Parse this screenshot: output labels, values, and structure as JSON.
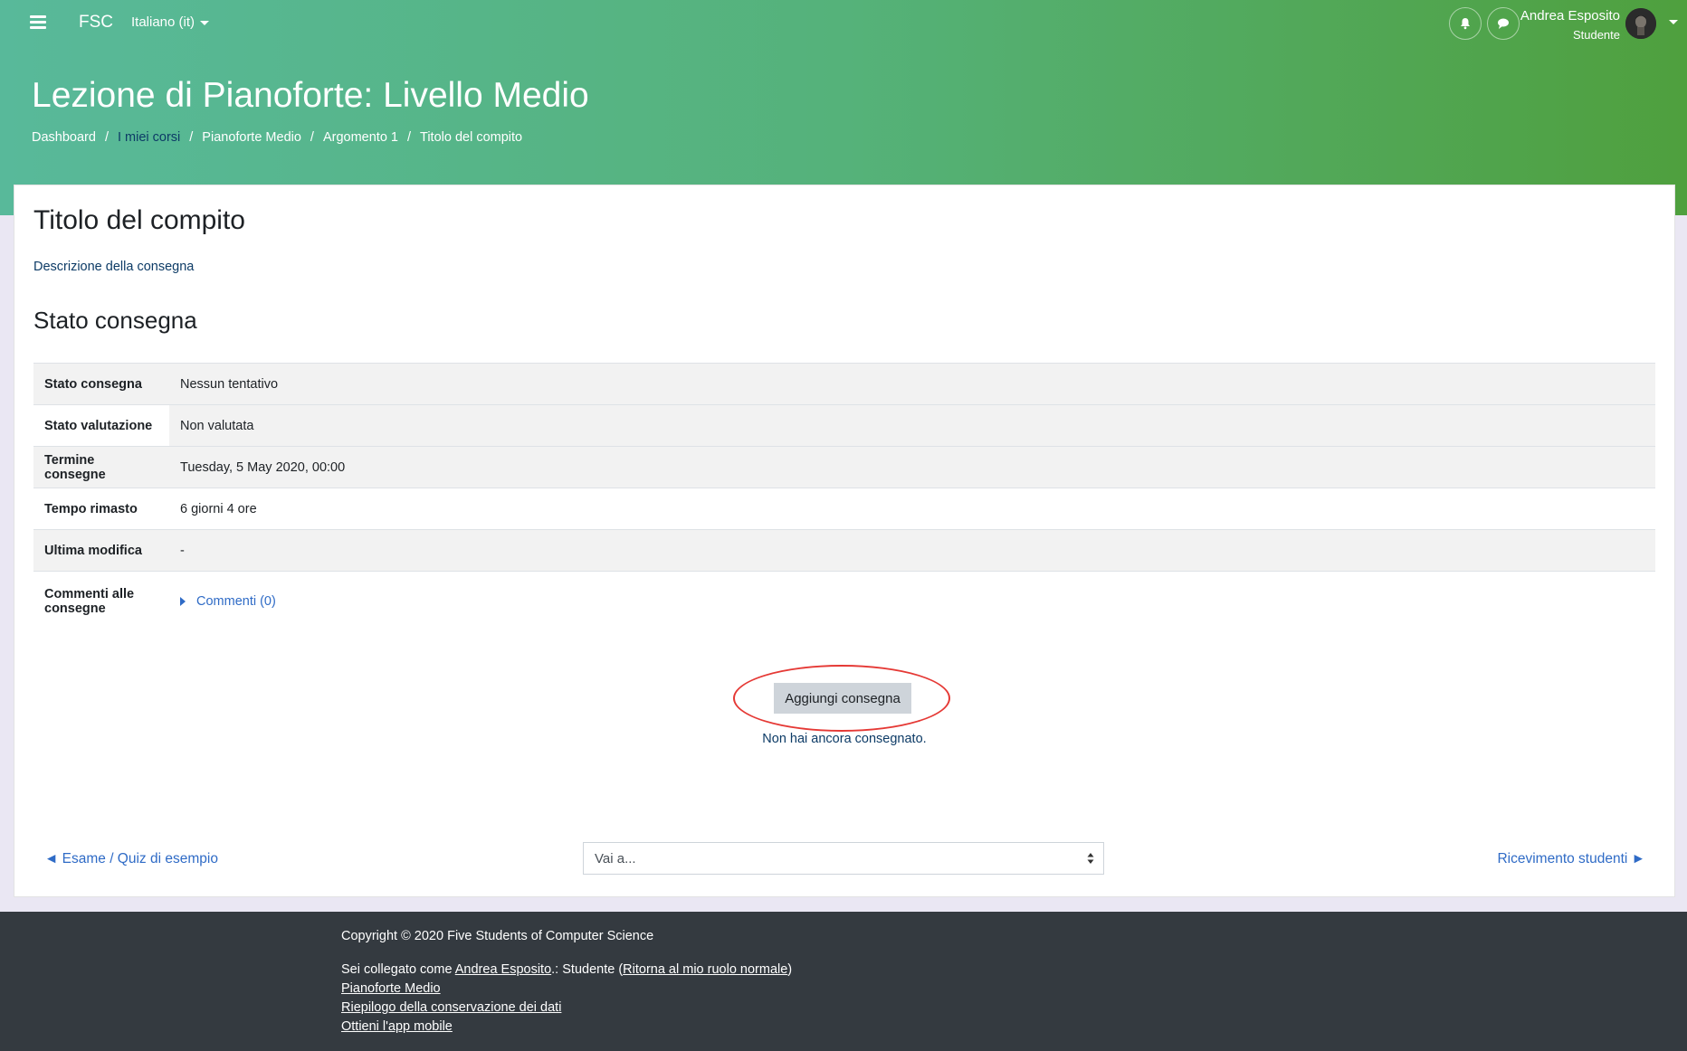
{
  "navbar": {
    "brand": "FSC",
    "language": "Italiano (it)",
    "user_name": "Andrea Esposito",
    "user_role": "Studente"
  },
  "header": {
    "title": "Lezione di Pianoforte: Livello Medio",
    "breadcrumb": [
      "Dashboard",
      "I miei corsi",
      "Pianoforte Medio",
      "Argomento 1",
      "Titolo del compito"
    ]
  },
  "main": {
    "heading": "Titolo del compito",
    "description": "Descrizione della consegna",
    "status_heading": "Stato consegna",
    "status_table": [
      {
        "label": "Stato consegna",
        "value": "Nessun tentativo"
      },
      {
        "label": "Stato valutazione",
        "value": "Non valutata"
      },
      {
        "label": "Termine consegne",
        "value": "Tuesday, 5 May 2020, 00:00"
      },
      {
        "label": "Tempo rimasto",
        "value": "6 giorni 4 ore"
      },
      {
        "label": "Ultima modifica",
        "value": "-"
      },
      {
        "label": "Commenti alle consegne",
        "value": "Commenti (0)"
      }
    ],
    "add_submission_label": "Aggiungi consegna",
    "not_submitted_text": "Non hai ancora consegnato."
  },
  "activity_nav": {
    "prev_label": "◄ Esame / Quiz di esempio",
    "jump_placeholder": "Vai a...",
    "next_label": "Ricevimento studenti ►"
  },
  "footer": {
    "copyright": "Copyright © 2020 Five Students of Computer Science",
    "logged_prefix": "Sei collegato come ",
    "logged_user": "Andrea Esposito",
    "logged_middle": ".: Studente (",
    "logged_return": "Ritorna al mio ruolo normale",
    "logged_suffix": ")",
    "link_course": "Pianoforte Medio",
    "link_data": "Riepilogo della conservazione dei dati",
    "link_app": "Ottieni l'app mobile"
  },
  "colors": {
    "header_gradient_start": "#58b99a",
    "header_gradient_end": "#4fa03e",
    "link": "#2f6bc6",
    "highlight_ellipse": "#e53935",
    "footer_bg": "#343a40"
  }
}
